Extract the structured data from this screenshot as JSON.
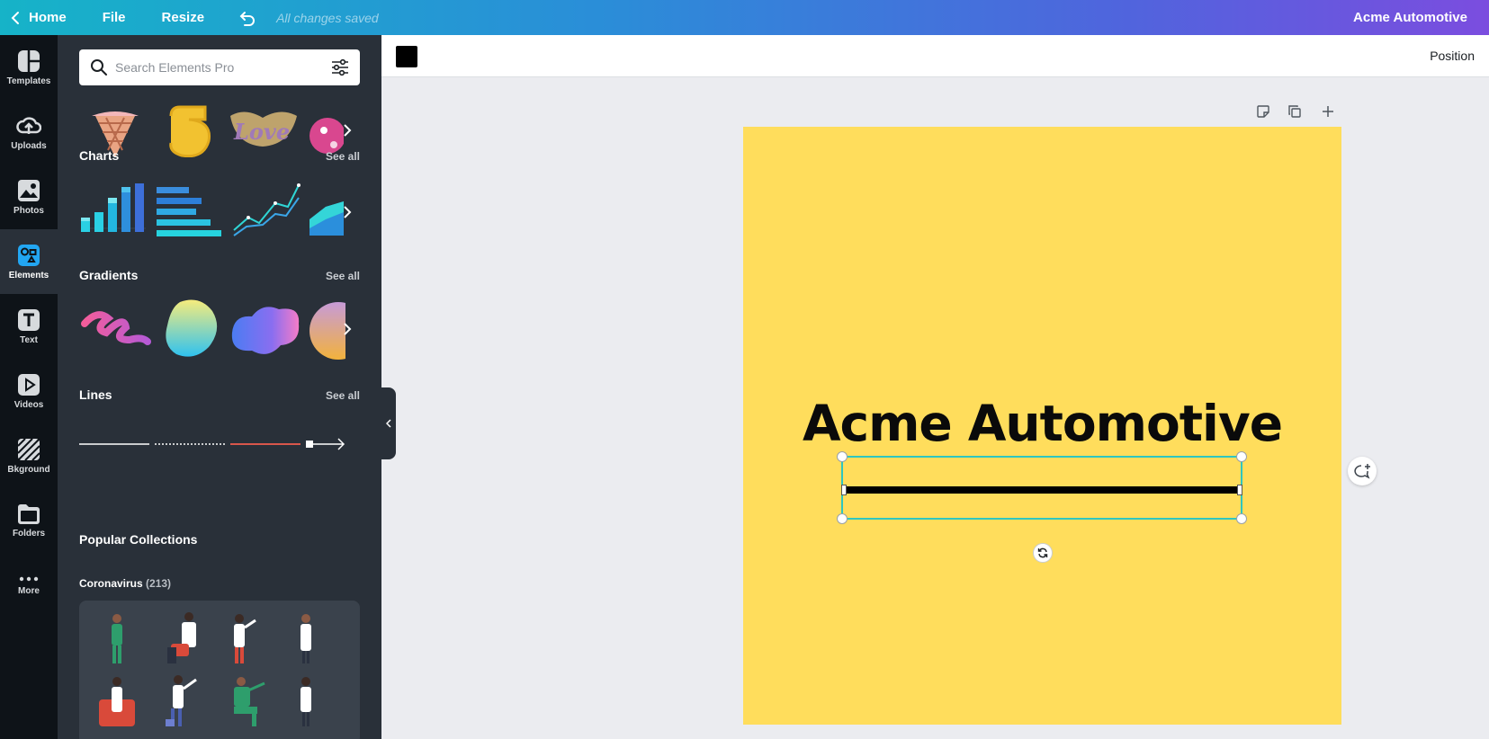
{
  "topbar": {
    "home": "Home",
    "file": "File",
    "resize": "Resize",
    "saved_status": "All changes saved",
    "doc_title": "Acme Automotive",
    "undo_icon": "undo-icon"
  },
  "rail": {
    "items": [
      {
        "label": "Templates",
        "icon": "templates-icon"
      },
      {
        "label": "Uploads",
        "icon": "upload-icon"
      },
      {
        "label": "Photos",
        "icon": "photos-icon"
      },
      {
        "label": "Elements",
        "icon": "elements-icon",
        "active": true
      },
      {
        "label": "Text",
        "icon": "text-icon"
      },
      {
        "label": "Videos",
        "icon": "video-icon"
      },
      {
        "label": "Bkground",
        "icon": "background-icon"
      },
      {
        "label": "Folders",
        "icon": "folder-icon"
      },
      {
        "label": "More",
        "icon": "more-icon"
      }
    ],
    "active_color": "#22a6f2"
  },
  "panel": {
    "search_placeholder": "Search Elements Pro",
    "sections": [
      {
        "title": "Charts",
        "see_all": "See all"
      },
      {
        "title": "Gradients",
        "see_all": "See all"
      },
      {
        "title": "Lines",
        "see_all": "See all"
      }
    ],
    "popular_title": "Popular Collections",
    "collection": {
      "name": "Coronavirus",
      "count": "(213)"
    }
  },
  "toolbar": {
    "text_color": "#000000",
    "position_label": "Position"
  },
  "canvas": {
    "background": "#ffdd5c",
    "headline": "Acme Automotive",
    "line_color": "#000000",
    "selection_color": "#2fc6c0"
  }
}
